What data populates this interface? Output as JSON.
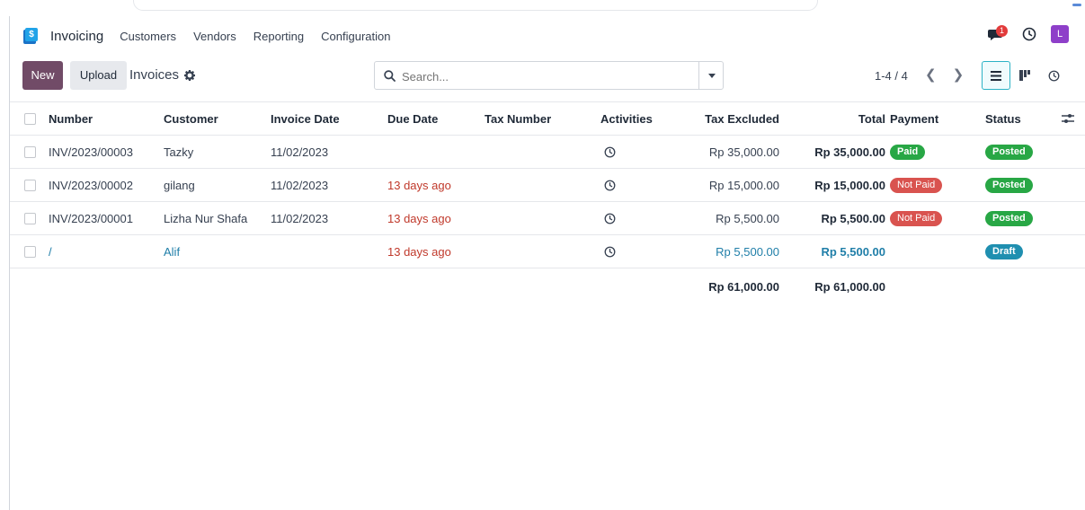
{
  "app": {
    "name": "Invoicing",
    "logo_letter": "$",
    "menu": [
      "Customers",
      "Vendors",
      "Reporting",
      "Configuration"
    ],
    "messages_badge": "1",
    "avatar_letter": "L"
  },
  "control": {
    "new_label": "New",
    "upload_label": "Upload",
    "breadcrumb": "Invoices",
    "search_placeholder": "Search...",
    "pager": "1-4 / 4"
  },
  "table": {
    "columns": {
      "number": "Number",
      "customer": "Customer",
      "invoice_date": "Invoice Date",
      "due_date": "Due Date",
      "tax_number": "Tax Number",
      "activities": "Activities",
      "tax_excluded": "Tax Excluded",
      "total": "Total",
      "payment": "Payment",
      "status": "Status"
    },
    "rows": [
      {
        "number": "INV/2023/00003",
        "customer": "Tazky",
        "invoice_date": "11/02/2023",
        "due_date": "",
        "tax_excluded": "Rp 35,000.00",
        "total": "Rp 35,000.00",
        "payment": "Paid",
        "status": "Posted"
      },
      {
        "number": "INV/2023/00002",
        "customer": "gilang",
        "invoice_date": "11/02/2023",
        "due_date": "13 days ago",
        "tax_excluded": "Rp 15,000.00",
        "total": "Rp 15,000.00",
        "payment": "Not Paid",
        "status": "Posted"
      },
      {
        "number": "INV/2023/00001",
        "customer": "Lizha Nur Shafa",
        "invoice_date": "11/02/2023",
        "due_date": "13 days ago",
        "tax_excluded": "Rp 5,500.00",
        "total": "Rp 5,500.00",
        "payment": "Not Paid",
        "status": "Posted"
      },
      {
        "number": "/",
        "customer": "Alif",
        "invoice_date": "",
        "due_date": "13 days ago",
        "tax_excluded": "Rp 5,500.00",
        "total": "Rp 5,500.00",
        "payment": "",
        "status": "Draft"
      }
    ],
    "totals": {
      "tax_excluded": "Rp 61,000.00",
      "total": "Rp 61,000.00"
    }
  },
  "colors": {
    "primary": "#714b67",
    "paid": "#28a745",
    "not_paid": "#d9534f",
    "draft": "#1f8fb0",
    "overdue": "#c0392b"
  }
}
